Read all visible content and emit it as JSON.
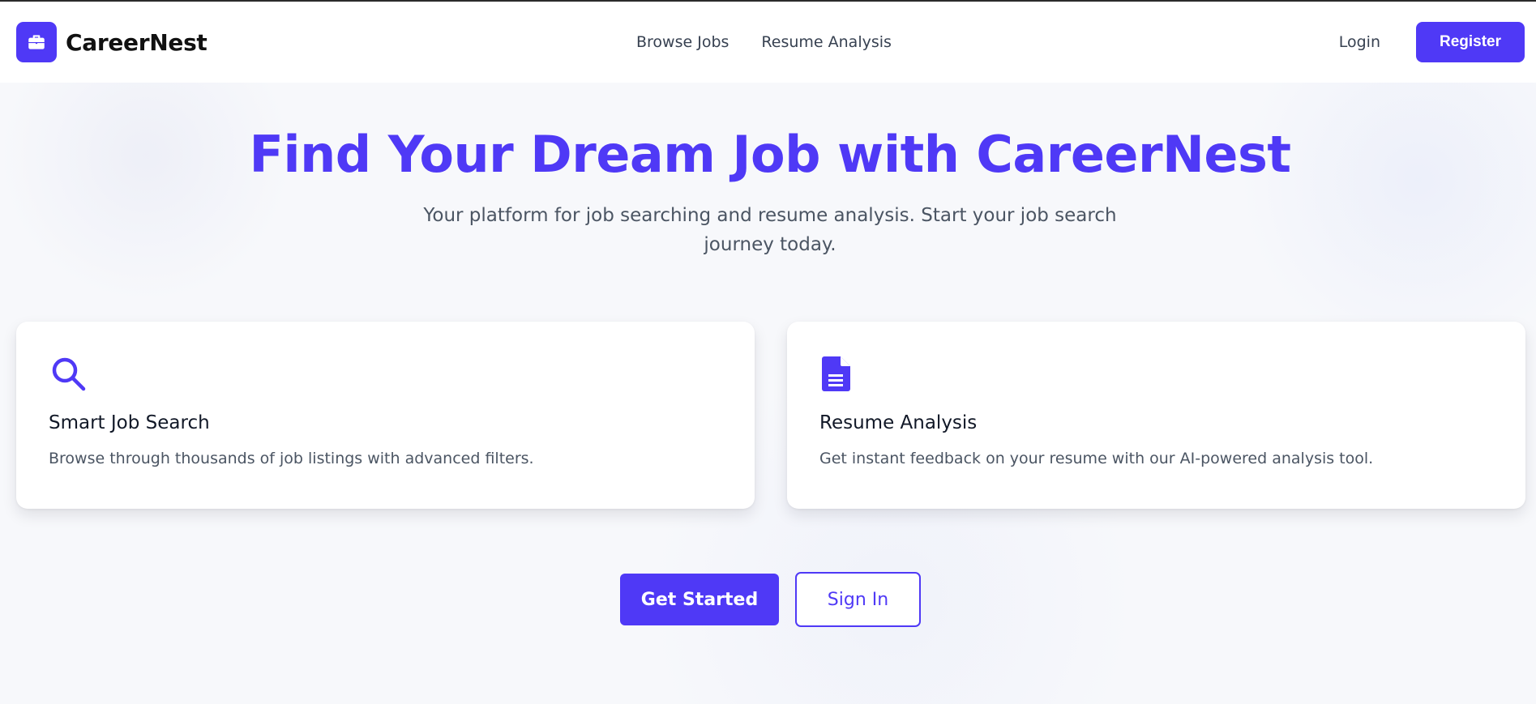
{
  "brand": {
    "name": "CareerNest",
    "logo_icon": "briefcase-icon"
  },
  "nav": {
    "links": [
      {
        "label": "Browse Jobs"
      },
      {
        "label": "Resume Analysis"
      }
    ],
    "login_label": "Login",
    "register_label": "Register"
  },
  "hero": {
    "title": "Find Your Dream Job with CareerNest",
    "subtitle": "Your platform for job searching and resume analysis. Start your job search journey today."
  },
  "features": [
    {
      "icon": "search-icon",
      "title": "Smart Job Search",
      "description": "Browse through thousands of job listings with advanced filters."
    },
    {
      "icon": "document-icon",
      "title": "Resume Analysis",
      "description": "Get instant feedback on your resume with our AI-powered analysis tool."
    }
  ],
  "cta": {
    "primary_label": "Get Started",
    "secondary_label": "Sign In"
  },
  "colors": {
    "accent": "#4f39f6",
    "page_bg": "#f7f8fb",
    "text_muted": "#4b5563"
  }
}
